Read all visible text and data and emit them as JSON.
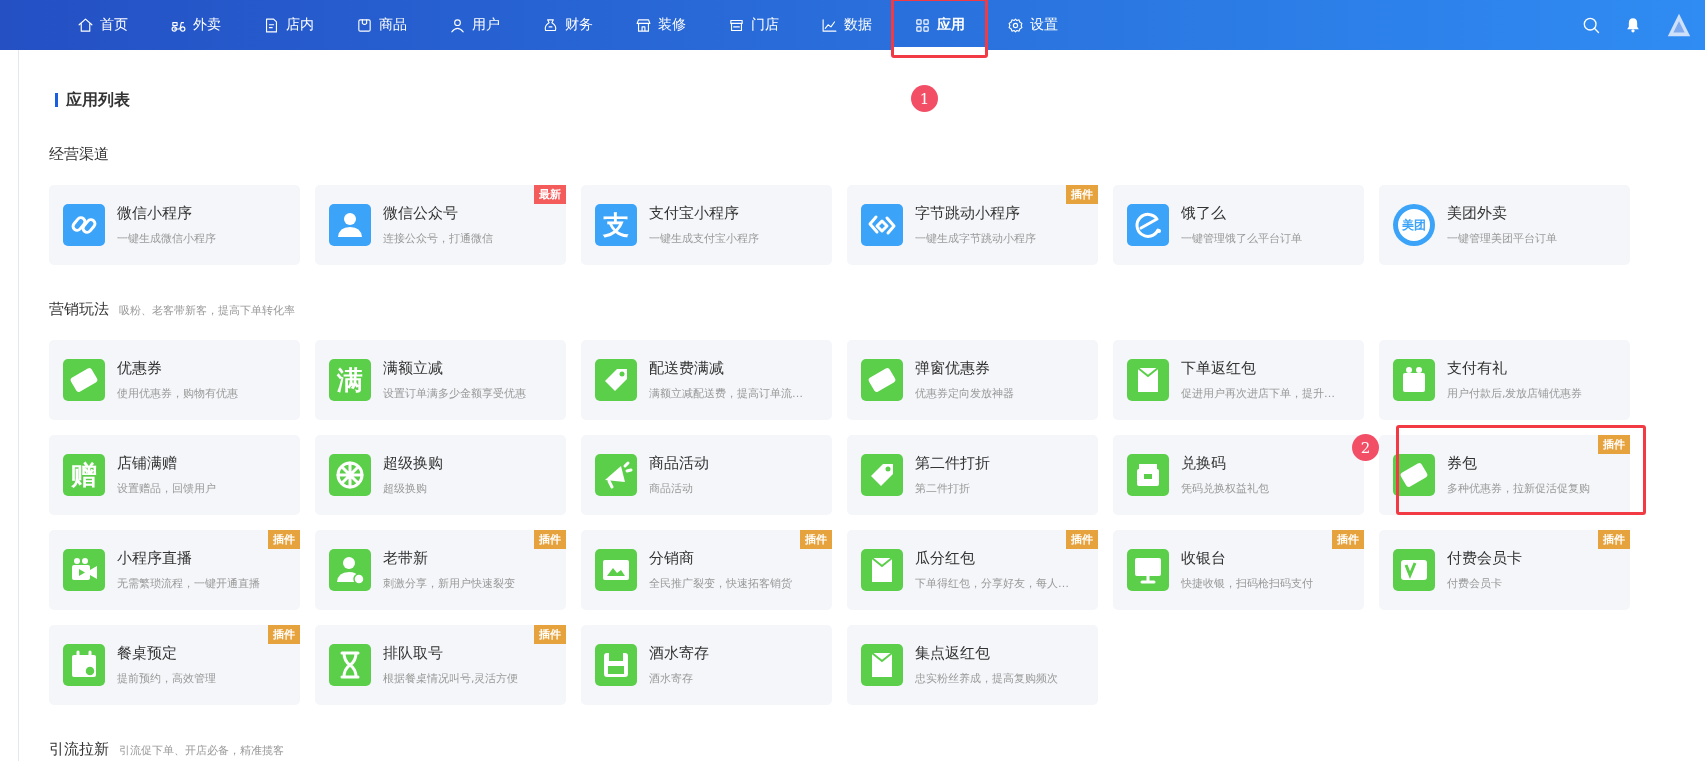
{
  "nav": {
    "items": [
      {
        "label": "首页",
        "selected": false,
        "highlighted": false
      },
      {
        "label": "外卖",
        "selected": false,
        "highlighted": false
      },
      {
        "label": "店内",
        "selected": false,
        "highlighted": false
      },
      {
        "label": "商品",
        "selected": false,
        "highlighted": false
      },
      {
        "label": "用户",
        "selected": false,
        "highlighted": false
      },
      {
        "label": "财务",
        "selected": false,
        "highlighted": false
      },
      {
        "label": "装修",
        "selected": false,
        "highlighted": false
      },
      {
        "label": "门店",
        "selected": false,
        "highlighted": false
      },
      {
        "label": "数据",
        "selected": false,
        "highlighted": false
      },
      {
        "label": "应用",
        "selected": true,
        "highlighted": true
      },
      {
        "label": "设置",
        "selected": false,
        "highlighted": false
      }
    ]
  },
  "page": {
    "title": "应用列表",
    "sections": [
      {
        "title": "经营渠道",
        "color": "#3ba3f8",
        "cards": [
          {
            "title": "微信小程序",
            "description": "一键生成微信小程序",
            "highlighted": false
          },
          {
            "title": "微信公众号",
            "description": "连接公众号，打通微信",
            "badge": {
              "text": "最新",
              "kind": "new"
            },
            "highlighted": false
          },
          {
            "title": "支付宝小程序",
            "description": "一键生成支付宝小程序",
            "icon_text": "支",
            "highlighted": false
          },
          {
            "title": "字节跳动小程序",
            "description": "一键生成字节跳动小程序",
            "badge": {
              "text": "插件",
              "kind": "plugin"
            },
            "highlighted": false
          },
          {
            "title": "饿了么",
            "description": "一键管理饿了么平台订单",
            "highlighted": false
          },
          {
            "title": "美团外卖",
            "description": "一键管理美团平台订单",
            "icon_text": "美团",
            "highlighted": false
          }
        ]
      },
      {
        "title": "营销玩法",
        "subtitle": "吸粉、老客带新客，提高下单转化率",
        "color": "#5ccf4a",
        "cards": [
          {
            "title": "优惠券",
            "description": "使用优惠券，购物有优惠",
            "highlighted": false
          },
          {
            "title": "满额立减",
            "description": "设置订单满多少金额享受优惠",
            "icon_text": "满",
            "highlighted": false
          },
          {
            "title": "配送费满减",
            "description": "满额立减配送费，提高订单流…",
            "highlighted": false
          },
          {
            "title": "弹窗优惠券",
            "description": "优惠券定向发放神器",
            "highlighted": false
          },
          {
            "title": "下单返红包",
            "description": "促进用户再次进店下单，提升…",
            "highlighted": false
          },
          {
            "title": "支付有礼",
            "description": "用户付款后,发放店铺优惠券",
            "highlighted": false
          },
          {
            "title": "店铺满赠",
            "description": "设置赠品，回馈用户",
            "icon_text": "赠",
            "highlighted": false
          },
          {
            "title": "超级换购",
            "description": "超级换购",
            "highlighted": false
          },
          {
            "title": "商品活动",
            "description": "商品活动",
            "highlighted": false
          },
          {
            "title": "第二件打折",
            "description": "第二件打折",
            "highlighted": false
          },
          {
            "title": "兑换码",
            "description": "凭码兑换权益礼包",
            "highlighted": false
          },
          {
            "title": "券包",
            "description": "多种优惠券，拉新促活促复购",
            "badge": {
              "text": "插件",
              "kind": "plugin"
            },
            "highlighted": true
          },
          {
            "title": "小程序直播",
            "description": "无需繁琐流程，一键开通直播",
            "badge": {
              "text": "插件",
              "kind": "plugin"
            },
            "highlighted": false
          },
          {
            "title": "老带新",
            "description": "刺激分享，新用户快速裂变",
            "badge": {
              "text": "插件",
              "kind": "plugin"
            },
            "highlighted": false
          },
          {
            "title": "分销商",
            "description": "全民推广裂变，快速拓客销货",
            "badge": {
              "text": "插件",
              "kind": "plugin"
            },
            "highlighted": false
          },
          {
            "title": "瓜分红包",
            "description": "下单得红包，分享好友，每人…",
            "badge": {
              "text": "插件",
              "kind": "plugin"
            },
            "highlighted": false
          },
          {
            "title": "收银台",
            "description": "快捷收银，扫码枪扫码支付",
            "badge": {
              "text": "插件",
              "kind": "plugin"
            },
            "highlighted": false
          },
          {
            "title": "付费会员卡",
            "description": "付费会员卡",
            "badge": {
              "text": "插件",
              "kind": "plugin"
            },
            "highlighted": false
          },
          {
            "title": "餐桌预定",
            "description": "提前预约，高效管理",
            "badge": {
              "text": "插件",
              "kind": "plugin"
            },
            "highlighted": false
          },
          {
            "title": "排队取号",
            "description": "根据餐桌情况叫号,灵活方便",
            "badge": {
              "text": "插件",
              "kind": "plugin"
            },
            "highlighted": false
          },
          {
            "title": "酒水寄存",
            "description": "酒水寄存",
            "highlighted": false
          },
          {
            "title": "集点返红包",
            "description": "忠实粉丝养成，提高复购频次",
            "highlighted": false
          }
        ]
      },
      {
        "title": "引流拉新",
        "subtitle": "引流促下单、开店必备，精准揽客"
      }
    ]
  },
  "annotations": [
    {
      "number": "1"
    },
    {
      "number": "2"
    }
  ]
}
